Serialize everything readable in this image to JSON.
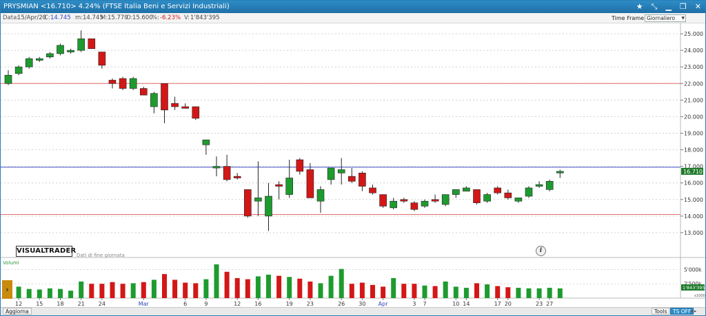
{
  "window": {
    "title": "PRYSMIAN <16.710> 4.24% (FTSE Italia Beni e Servizi Industriali)",
    "icons": [
      "star-icon",
      "tools-icon",
      "minimize-icon",
      "restore-icon",
      "close-icon"
    ]
  },
  "infobar": {
    "date_label": "Data:",
    "date": "15/Apr/20",
    "close_label": "C:",
    "close": "14.745",
    "min_label": "m:",
    "min": "14.745",
    "max_label": "M:",
    "max": "15.770",
    "open_label": "O:",
    "open": "15.600",
    "pct_label": "%:",
    "pct": "-6.23%",
    "vol_label": "V:",
    "volume": "1'843'395",
    "timeframe_label": "Time Frame",
    "timeframe_value": "Giornaliero"
  },
  "logo": {
    "text": "VISUALTRADER",
    "subtitle": "Dati di fine giornata"
  },
  "volume_pane": {
    "label": "Volumi",
    "axis": [
      "5'000k",
      "2'500k",
      "x1000"
    ],
    "current": "1'843'395"
  },
  "price_tag": "16.710",
  "bottombar": {
    "left": "Aggiorna",
    "tools": "Tools",
    "ts": "TS OFF",
    "arrows": "◂ ▸"
  },
  "colors": {
    "up": "#1e9b2e",
    "down": "#d31717",
    "hline_red": "#e46a6a",
    "hline_blue": "#3b4fc7",
    "tag": "#1e7a2a"
  },
  "chart_data": {
    "type": "candlestick",
    "y_axis": {
      "min": 12.5,
      "max": 25.5,
      "ticks": [
        "25.000",
        "24.000",
        "23.000",
        "22.000",
        "21.000",
        "20.000",
        "19.000",
        "18.000",
        "17.000",
        "16.000",
        "15.000",
        "14.000",
        "13.000"
      ]
    },
    "x_ticks": [
      "12",
      "15",
      "18",
      "21",
      "24",
      "Mar",
      "6",
      "9",
      "12",
      "16",
      "19",
      "23",
      "26",
      "30",
      "Apr",
      "3",
      "7",
      "10",
      "14",
      "17",
      "20",
      "23",
      "27"
    ],
    "x_tick_marks": [
      {
        "label": "12",
        "i": 1
      },
      {
        "label": "15",
        "i": 3
      },
      {
        "label": "18",
        "i": 5
      },
      {
        "label": "21",
        "i": 7
      },
      {
        "label": "24",
        "i": 9
      },
      {
        "label": "Mar",
        "i": 13
      },
      {
        "label": "6",
        "i": 17
      },
      {
        "label": "9",
        "i": 19
      },
      {
        "label": "12",
        "i": 22
      },
      {
        "label": "16",
        "i": 24
      },
      {
        "label": "19",
        "i": 27
      },
      {
        "label": "23",
        "i": 29
      },
      {
        "label": "26",
        "i": 32
      },
      {
        "label": "30",
        "i": 34
      },
      {
        "label": "Apr",
        "i": 36
      },
      {
        "label": "3",
        "i": 39
      },
      {
        "label": "7",
        "i": 40
      },
      {
        "label": "10",
        "i": 43
      },
      {
        "label": "14",
        "i": 44
      },
      {
        "label": "17",
        "i": 47
      },
      {
        "label": "20",
        "i": 48
      },
      {
        "label": "23",
        "i": 51
      },
      {
        "label": "27",
        "i": 52
      }
    ],
    "hlines": [
      {
        "value": 22.0,
        "color": "red"
      },
      {
        "value": 16.95,
        "color": "blue"
      },
      {
        "value": 14.1,
        "color": "red"
      }
    ],
    "candles": [
      {
        "o": 22.0,
        "h": 22.8,
        "l": 21.9,
        "c": 22.5
      },
      {
        "o": 22.6,
        "h": 23.1,
        "l": 22.5,
        "c": 23.0
      },
      {
        "o": 23.0,
        "h": 23.6,
        "l": 22.9,
        "c": 23.5
      },
      {
        "o": 23.4,
        "h": 23.6,
        "l": 23.3,
        "c": 23.5
      },
      {
        "o": 23.6,
        "h": 23.9,
        "l": 23.5,
        "c": 23.8
      },
      {
        "o": 23.8,
        "h": 24.4,
        "l": 23.7,
        "c": 24.3
      },
      {
        "o": 23.9,
        "h": 24.1,
        "l": 23.8,
        "c": 24.0
      },
      {
        "o": 24.0,
        "h": 25.2,
        "l": 23.9,
        "c": 24.7
      },
      {
        "o": 24.7,
        "h": 24.7,
        "l": 24.1,
        "c": 24.1
      },
      {
        "o": 23.9,
        "h": 23.9,
        "l": 22.9,
        "c": 23.1
      },
      {
        "o": 22.2,
        "h": 22.3,
        "l": 21.7,
        "c": 22.0
      },
      {
        "o": 22.3,
        "h": 22.4,
        "l": 21.6,
        "c": 21.7
      },
      {
        "o": 21.7,
        "h": 22.4,
        "l": 21.6,
        "c": 22.3
      },
      {
        "o": 21.7,
        "h": 21.8,
        "l": 21.3,
        "c": 21.3
      },
      {
        "o": 20.6,
        "h": 21.5,
        "l": 20.2,
        "c": 21.4
      },
      {
        "o": 22.0,
        "h": 22.0,
        "l": 19.6,
        "c": 20.4
      },
      {
        "o": 20.8,
        "h": 21.2,
        "l": 20.4,
        "c": 20.6
      },
      {
        "o": 20.6,
        "h": 20.8,
        "l": 20.5,
        "c": 20.5
      },
      {
        "o": 20.6,
        "h": 20.6,
        "l": 19.8,
        "c": 19.9
      },
      {
        "o": 18.3,
        "h": 18.6,
        "l": 17.7,
        "c": 18.6
      },
      {
        "o": 16.9,
        "h": 17.6,
        "l": 16.4,
        "c": 17.0
      },
      {
        "o": 17.0,
        "h": 17.7,
        "l": 16.1,
        "c": 16.2
      },
      {
        "o": 16.4,
        "h": 16.6,
        "l": 16.2,
        "c": 16.3
      },
      {
        "o": 15.6,
        "h": 15.6,
        "l": 13.9,
        "c": 14.0
      },
      {
        "o": 14.9,
        "h": 17.3,
        "l": 14.0,
        "c": 15.1
      },
      {
        "o": 14.0,
        "h": 16.0,
        "l": 13.1,
        "c": 15.2
      },
      {
        "o": 15.9,
        "h": 16.1,
        "l": 15.0,
        "c": 15.8
      },
      {
        "o": 15.3,
        "h": 17.4,
        "l": 15.1,
        "c": 16.3
      },
      {
        "o": 17.4,
        "h": 17.5,
        "l": 16.5,
        "c": 16.7
      },
      {
        "o": 16.8,
        "h": 17.2,
        "l": 15.1,
        "c": 15.1
      },
      {
        "o": 14.9,
        "h": 15.8,
        "l": 14.2,
        "c": 15.6
      },
      {
        "o": 16.2,
        "h": 16.9,
        "l": 15.9,
        "c": 16.9
      },
      {
        "o": 16.6,
        "h": 17.5,
        "l": 15.9,
        "c": 16.8
      },
      {
        "o": 16.4,
        "h": 16.9,
        "l": 16.0,
        "c": 16.1
      },
      {
        "o": 16.6,
        "h": 16.7,
        "l": 15.5,
        "c": 15.8
      },
      {
        "o": 15.7,
        "h": 15.9,
        "l": 15.3,
        "c": 15.4
      },
      {
        "o": 15.3,
        "h": 15.3,
        "l": 14.5,
        "c": 14.6
      },
      {
        "o": 14.5,
        "h": 15.1,
        "l": 14.4,
        "c": 14.9
      },
      {
        "o": 15.0,
        "h": 15.1,
        "l": 14.8,
        "c": 14.9
      },
      {
        "o": 14.8,
        "h": 14.9,
        "l": 14.3,
        "c": 14.4
      },
      {
        "o": 14.6,
        "h": 15.0,
        "l": 14.5,
        "c": 14.9
      },
      {
        "o": 15.0,
        "h": 15.3,
        "l": 14.8,
        "c": 14.9
      },
      {
        "o": 14.7,
        "h": 15.3,
        "l": 14.6,
        "c": 15.3
      },
      {
        "o": 15.3,
        "h": 15.6,
        "l": 15.1,
        "c": 15.6
      },
      {
        "o": 15.5,
        "h": 15.8,
        "l": 15.5,
        "c": 15.7
      },
      {
        "o": 15.6,
        "h": 15.6,
        "l": 14.7,
        "c": 14.8
      },
      {
        "o": 14.9,
        "h": 15.4,
        "l": 14.8,
        "c": 15.3
      },
      {
        "o": 15.7,
        "h": 15.8,
        "l": 15.3,
        "c": 15.4
      },
      {
        "o": 15.4,
        "h": 15.6,
        "l": 15.0,
        "c": 15.1
      },
      {
        "o": 14.9,
        "h": 15.1,
        "l": 14.8,
        "c": 15.1
      },
      {
        "o": 15.2,
        "h": 15.8,
        "l": 15.1,
        "c": 15.7
      },
      {
        "o": 15.8,
        "h": 16.1,
        "l": 15.7,
        "c": 15.9
      },
      {
        "o": 15.6,
        "h": 16.2,
        "l": 15.5,
        "c": 16.1
      },
      {
        "o": 16.6,
        "h": 16.8,
        "l": 16.3,
        "c": 16.7
      }
    ],
    "volume_ticks": [
      "5'000",
      "2'500"
    ],
    "volume_max": 6500,
    "volumes": [
      2700,
      2000,
      1600,
      1500,
      1700,
      1600,
      1300,
      2900,
      2500,
      2500,
      2800,
      2500,
      2600,
      2800,
      3200,
      4200,
      3200,
      2700,
      2600,
      3300,
      5900,
      4600,
      3500,
      3300,
      3800,
      4100,
      3900,
      3700,
      3400,
      2900,
      2600,
      3900,
      5100,
      2500,
      2700,
      2300,
      2000,
      3500,
      2500,
      2500,
      2200,
      2100,
      2900,
      2000,
      1800,
      2600,
      2400,
      2100,
      1900,
      1800,
      1700,
      1700,
      1800,
      1700
    ]
  }
}
